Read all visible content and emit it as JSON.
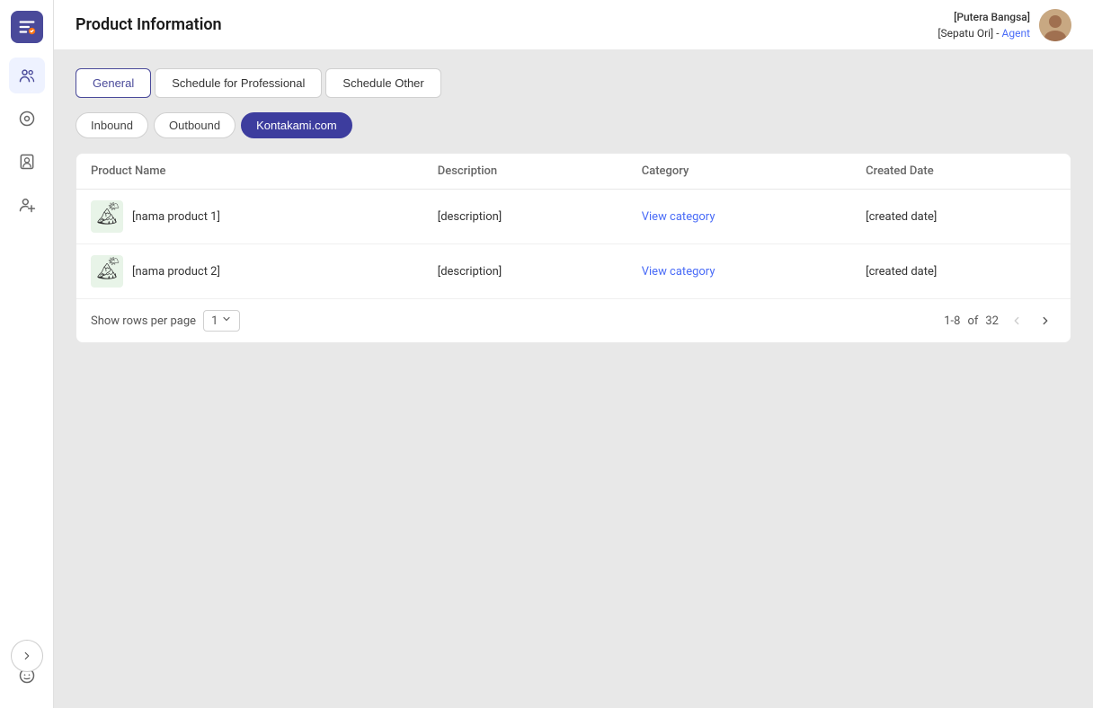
{
  "app": {
    "title": "Product Information"
  },
  "header": {
    "title": "Product Information",
    "user": {
      "name_line1": "[Putera Bangsa]",
      "name_line2": "[Sepatu Ori]",
      "separator": " - ",
      "role": "Agent"
    }
  },
  "tabs": [
    {
      "id": "general",
      "label": "General",
      "active": true
    },
    {
      "id": "schedule-pro",
      "label": "Schedule for Professional",
      "active": false
    },
    {
      "id": "schedule-other",
      "label": "Schedule Other",
      "active": false
    }
  ],
  "filter_tabs": [
    {
      "id": "inbound",
      "label": "Inbound",
      "active": false
    },
    {
      "id": "outbound",
      "label": "Outbound",
      "active": false
    },
    {
      "id": "kontakami",
      "label": "Kontakami.com",
      "active": true
    }
  ],
  "table": {
    "columns": [
      {
        "id": "product_name",
        "label": "Product Name"
      },
      {
        "id": "description",
        "label": "Description"
      },
      {
        "id": "category",
        "label": "Category"
      },
      {
        "id": "created_date",
        "label": "Created Date"
      }
    ],
    "rows": [
      {
        "product_name": "[nama product 1]",
        "description": "[description]",
        "category_label": "View category",
        "created_date": "[created date]"
      },
      {
        "product_name": "[nama product 2]",
        "description": "[description]",
        "category_label": "View category",
        "created_date": "[created date]"
      }
    ]
  },
  "pagination": {
    "rows_per_page_label": "Show rows per page",
    "rows_per_page_value": "1",
    "range": "1-8",
    "total_label": "of",
    "total": "32"
  },
  "sidebar": {
    "icons": [
      {
        "id": "team",
        "title": "Team"
      },
      {
        "id": "circle",
        "title": "Status"
      },
      {
        "id": "contact",
        "title": "Contact"
      },
      {
        "id": "user-plus",
        "title": "Add User"
      },
      {
        "id": "smiley",
        "title": "Emoji"
      }
    ]
  },
  "colors": {
    "accent": "#3d3d9e",
    "link": "#4a6cf7"
  }
}
